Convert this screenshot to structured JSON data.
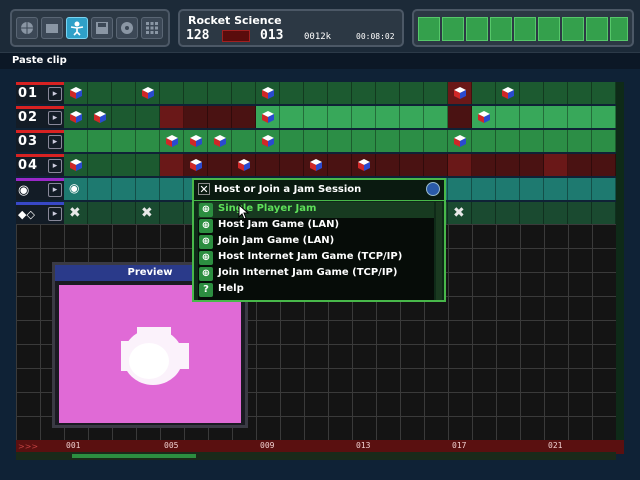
{
  "app": {
    "song_title": "Rocket Science",
    "tempo": "128",
    "bars": "013",
    "size": "0012k",
    "time": "00:08:02",
    "clip_label": "Paste clip",
    "toolbar": {
      "tools": [
        "globe-icon",
        "folder-icon",
        "person-icon",
        "save-icon",
        "disc-icon",
        "grid-icon"
      ],
      "active_tool": "person-icon"
    },
    "meter_level": 1.0
  },
  "tracks": [
    {
      "label": "01",
      "accent": "#d82222"
    },
    {
      "label": "02",
      "accent": "#d82222"
    },
    {
      "label": "03",
      "accent": "#d82222"
    },
    {
      "label": "04",
      "accent": "#d82222"
    },
    {
      "label": "",
      "icon": "camera-icon",
      "accent": "#9a28c8"
    },
    {
      "label": "",
      "icon": "effects-icon",
      "accent": "#3848c8"
    }
  ],
  "timeline": {
    "ticks": [
      "001",
      "005",
      "009",
      "013",
      "017",
      "021"
    ]
  },
  "preview": {
    "title": "Preview"
  },
  "dialog": {
    "title": "Host or Join a Jam Session",
    "items": [
      {
        "label": "Single Player Jam",
        "icon": "globe-icon",
        "selected": true
      },
      {
        "label": "Host Jam Game (LAN)",
        "icon": "globe-icon",
        "selected": false
      },
      {
        "label": "Join Jam Game (LAN)",
        "icon": "globe-icon",
        "selected": false
      },
      {
        "label": "Host Internet Jam Game (TCP/IP)",
        "icon": "globe-icon",
        "selected": false
      },
      {
        "label": "Join Internet Jam Game (TCP/IP)",
        "icon": "globe-icon",
        "selected": false
      },
      {
        "label": "Help",
        "icon": "help-icon",
        "selected": false
      }
    ]
  },
  "colors": {
    "accent_green": "#48b84a",
    "selected_text": "#5ee05a",
    "preview_bg": "#e06ad6"
  }
}
